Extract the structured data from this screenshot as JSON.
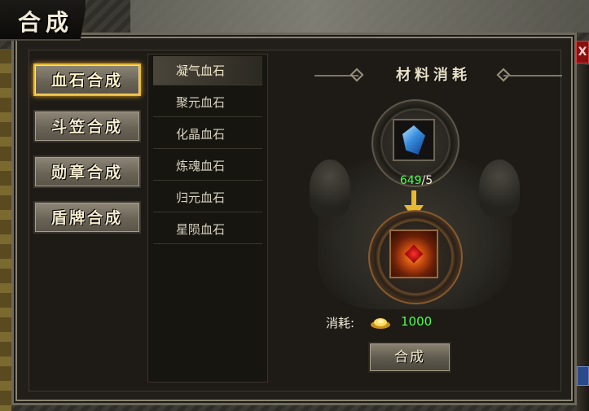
{
  "window": {
    "title": "合成"
  },
  "categories": [
    {
      "label": "血石合成",
      "active": true
    },
    {
      "label": "斗笠合成",
      "active": false
    },
    {
      "label": "勋章合成",
      "active": false
    },
    {
      "label": "盾牌合成",
      "active": false
    }
  ],
  "items": [
    {
      "label": "凝气血石",
      "active": true
    },
    {
      "label": "聚元血石",
      "active": false
    },
    {
      "label": "化晶血石",
      "active": false
    },
    {
      "label": "炼魂血石",
      "active": false
    },
    {
      "label": "归元血石",
      "active": false
    },
    {
      "label": "星陨血石",
      "active": false
    }
  ],
  "materials": {
    "header": "材料消耗",
    "have": "649",
    "need": "/5"
  },
  "cost": {
    "label": "消耗:",
    "value": "1000"
  },
  "craft_button": "合成",
  "close_label": "X"
}
